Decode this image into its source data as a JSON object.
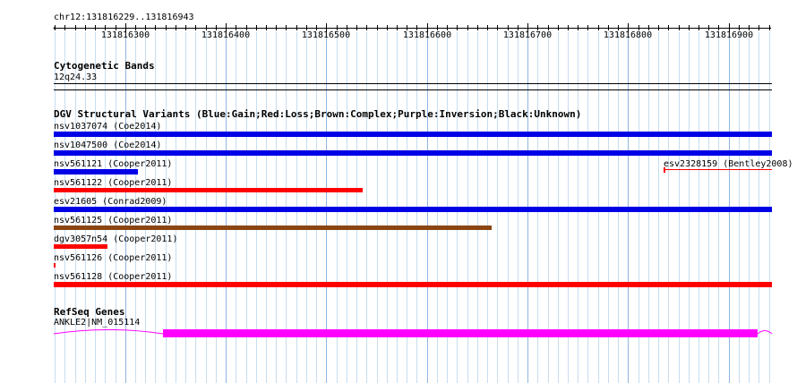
{
  "ruler": {
    "range_label": "chr12:131816229..131816943",
    "start": 131816229,
    "end": 131816943,
    "ticks": [
      "131816300",
      "131816400",
      "131816500",
      "131816600",
      "131816700",
      "131816800",
      "131816900"
    ]
  },
  "cytoband": {
    "title": "Cytogenetic Bands",
    "band": "12q24.33"
  },
  "dgv": {
    "title": "DGV Structural Variants (Blue:Gain;Red:Loss;Brown:Complex;Purple:Inversion;Black:Unknown)",
    "colors": {
      "gain": "#0000e6",
      "loss": "#ff0000",
      "complex": "#8b4513"
    },
    "variants": [
      {
        "label": "nsv1037074 (Coe2014)",
        "type": "gain",
        "start": 131816229,
        "end": 131816943
      },
      {
        "label": "nsv1047500 (Coe2014)",
        "type": "gain",
        "start": 131816229,
        "end": 131816943
      },
      {
        "label": "nsv561121 (Cooper2011)",
        "type": "gain",
        "start": 131816229,
        "end": 131816313
      },
      {
        "label": "esv2328159 (Bentley2008)",
        "type": "loss",
        "start": 131816835,
        "end": 131816943
      },
      {
        "label": "nsv561122 (Cooper2011)",
        "type": "loss",
        "start": 131816229,
        "end": 131816536
      },
      {
        "label": "esv21605 (Conrad2009)",
        "type": "gain",
        "start": 131816229,
        "end": 131816943
      },
      {
        "label": "nsv561125 (Cooper2011)",
        "type": "complex",
        "start": 131816229,
        "end": 131816664
      },
      {
        "label": "dgv3057n54 (Cooper2011)",
        "type": "loss",
        "start": 131816229,
        "end": 131816282
      },
      {
        "label": "nsv561126 (Cooper2011)",
        "type": "loss",
        "start": 131816229,
        "end": 131816231
      },
      {
        "label": "nsv561128 (Cooper2011)",
        "type": "loss",
        "start": 131816229,
        "end": 131816943
      }
    ]
  },
  "refseq": {
    "title": "RefSeq Genes",
    "gene_label": "ANKLE2|NM_015114",
    "exon_color": "#ff00ff",
    "intron_color": "#ff00ff",
    "exon_start": 131816338,
    "exon_end": 131816929
  }
}
